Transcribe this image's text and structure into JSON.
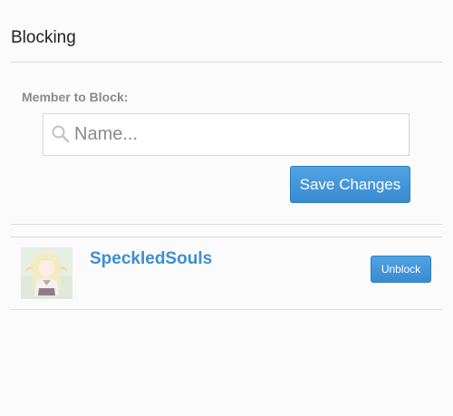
{
  "page": {
    "title": "Blocking"
  },
  "form": {
    "member_label": "Member to Block:",
    "search_placeholder": "Name...",
    "search_value": "",
    "save_label": "Save Changes"
  },
  "blocked": [
    {
      "username": "SpeckledSouls",
      "action_label": "Unblock"
    }
  ],
  "colors": {
    "accent": "#3d8fcf",
    "button": "#3a8ad0",
    "divider": "#dcdcdc"
  },
  "icons": {
    "search": "search-icon",
    "avatar": "avatar-image"
  }
}
